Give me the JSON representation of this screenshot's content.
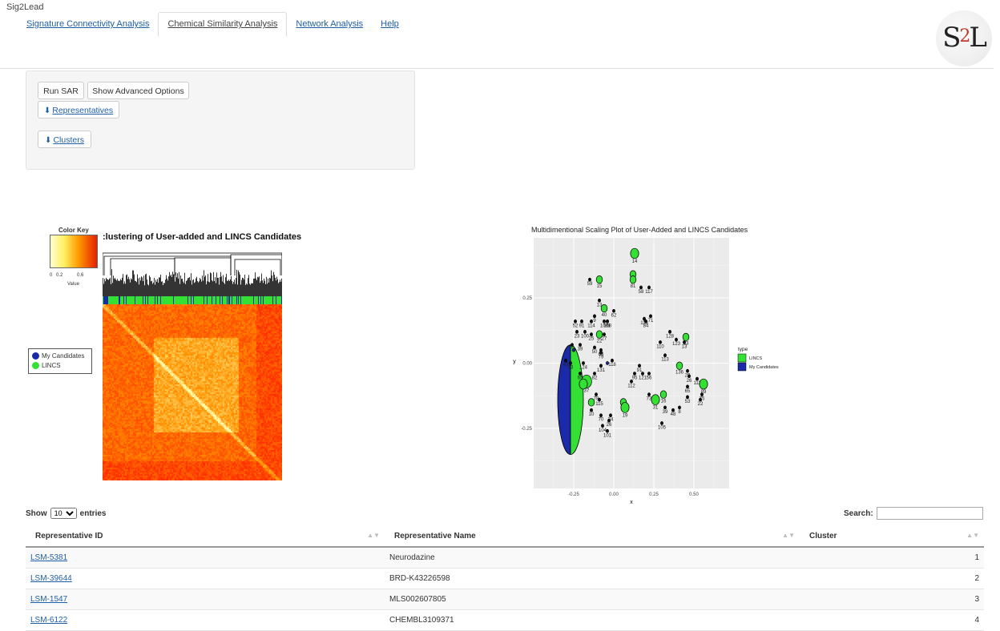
{
  "app": {
    "title": "Sig2Lead",
    "logo_text_s": "S",
    "logo_text_2": "2",
    "logo_text_l": "L"
  },
  "tabs": [
    {
      "label": "Signature Connectivity Analysis",
      "active": false
    },
    {
      "label": "Chemical Similarity Analysis",
      "active": true
    },
    {
      "label": "Network Analysis",
      "active": false
    },
    {
      "label": "Help",
      "active": false
    }
  ],
  "controls": {
    "run_sar": "Run SAR",
    "show_advanced": "Show Advanced Options",
    "representatives": "Representatives",
    "clusters": "Clusters",
    "download_icon": "download-icon"
  },
  "heatmap": {
    "title": ":lustering of User-added and LINCS Candidates",
    "color_key_title": "Color Key",
    "color_key_ticks": [
      "0",
      "0.2",
      "0.6"
    ],
    "color_key_label": "Value",
    "legend": [
      {
        "label": "My Candidates",
        "color": "#1a2aa8"
      },
      {
        "label": "LINCS",
        "color": "#33e033"
      }
    ]
  },
  "chart_data": {
    "type": "scatter",
    "title": "Multidimentional Scaling Plot of User-Added and LINCS Candidates",
    "xlabel": "x",
    "ylabel": "y",
    "xlim": [
      -0.5,
      0.72
    ],
    "ylim": [
      -0.48,
      0.48
    ],
    "x_ticks": [
      "-0.25",
      "0.00",
      "0.25",
      "0.50"
    ],
    "y_ticks": [
      "0.25",
      "0.00",
      "-0.25"
    ],
    "legend_title": "type",
    "legend": [
      {
        "label": "LINCS",
        "color": "#33e033"
      },
      {
        "label": "My Candidates",
        "color": "#1a2aa8"
      }
    ],
    "grid": true,
    "big_point": {
      "x": -0.27,
      "y": -0.14,
      "rx": 0.08,
      "ry": 0.21
    },
    "points": [
      {
        "x": 0.13,
        "y": 0.42,
        "label": "14",
        "s": 4
      },
      {
        "x": 0.12,
        "y": 0.34,
        "label": "12",
        "s": 3
      },
      {
        "x": 0.12,
        "y": 0.32,
        "label": "81",
        "s": 3
      },
      {
        "x": 0.17,
        "y": 0.29,
        "label": "58",
        "s": 2
      },
      {
        "x": 0.22,
        "y": 0.29,
        "label": "117",
        "s": 2
      },
      {
        "x": -0.15,
        "y": 0.32,
        "label": "59",
        "s": 2
      },
      {
        "x": -0.09,
        "y": 0.32,
        "label": "15",
        "s": 3
      },
      {
        "x": -0.09,
        "y": 0.24,
        "label": "13",
        "s": 2
      },
      {
        "x": -0.06,
        "y": 0.21,
        "label": "40",
        "s": 3
      },
      {
        "x": 0.0,
        "y": 0.2,
        "label": "62",
        "s": 2
      },
      {
        "x": -0.04,
        "y": 0.16,
        "label": "98",
        "s": 2
      },
      {
        "x": -0.12,
        "y": 0.18,
        "label": "9",
        "s": 2
      },
      {
        "x": 0.23,
        "y": 0.18,
        "label": "71",
        "s": 2
      },
      {
        "x": 0.19,
        "y": 0.17,
        "label": "116",
        "s": 2
      },
      {
        "x": 0.2,
        "y": 0.16,
        "label": "84",
        "s": 2
      },
      {
        "x": -0.24,
        "y": 0.16,
        "label": "52",
        "s": 2
      },
      {
        "x": -0.2,
        "y": 0.16,
        "label": "91",
        "s": 2
      },
      {
        "x": -0.14,
        "y": 0.16,
        "label": "114",
        "s": 2
      },
      {
        "x": -0.06,
        "y": 0.16,
        "label": "107",
        "s": 2
      },
      {
        "x": -0.04,
        "y": 0.16,
        "label": "108",
        "s": 2
      },
      {
        "x": -0.23,
        "y": 0.12,
        "label": "23",
        "s": 2
      },
      {
        "x": -0.18,
        "y": 0.12,
        "label": "100",
        "s": 2
      },
      {
        "x": -0.14,
        "y": 0.11,
        "label": "25",
        "s": 2
      },
      {
        "x": -0.09,
        "y": 0.11,
        "label": "22",
        "s": 3
      },
      {
        "x": -0.06,
        "y": 0.11,
        "label": "27",
        "s": 2
      },
      {
        "x": 0.35,
        "y": 0.12,
        "label": "128",
        "s": 2
      },
      {
        "x": 0.39,
        "y": 0.09,
        "label": "123",
        "s": 2
      },
      {
        "x": 0.45,
        "y": 0.1,
        "label": "83",
        "s": 3
      },
      {
        "x": 0.44,
        "y": 0.08,
        "label": "13",
        "s": 2
      },
      {
        "x": 0.29,
        "y": 0.08,
        "label": "110",
        "s": 2
      },
      {
        "x": -0.26,
        "y": 0.07,
        "label": "28",
        "s": 2
      },
      {
        "x": -0.21,
        "y": 0.07,
        "label": "39",
        "s": 2
      },
      {
        "x": -0.12,
        "y": 0.06,
        "label": "50",
        "s": 2
      },
      {
        "x": -0.08,
        "y": 0.05,
        "label": "63",
        "s": 2
      },
      {
        "x": -0.08,
        "y": 0.04,
        "label": "79",
        "s": 2
      },
      {
        "x": 0.32,
        "y": 0.03,
        "label": "113",
        "s": 2
      },
      {
        "x": -0.3,
        "y": 0.01,
        "label": "43",
        "s": 2
      },
      {
        "x": -0.27,
        "y": 0.0,
        "label": "33",
        "s": 2
      },
      {
        "x": -0.19,
        "y": 0.0,
        "label": "124",
        "s": 2
      },
      {
        "x": -0.01,
        "y": 0.01,
        "label": "118",
        "s": 2
      },
      {
        "x": -0.08,
        "y": -0.01,
        "label": "131",
        "s": 2
      },
      {
        "x": 0.16,
        "y": -0.01,
        "label": "91",
        "s": 2
      },
      {
        "x": 0.41,
        "y": -0.01,
        "label": "136",
        "s": 3
      },
      {
        "x": 0.46,
        "y": -0.03,
        "label": "29",
        "s": 2
      },
      {
        "x": 0.13,
        "y": -0.04,
        "label": "95",
        "s": 2
      },
      {
        "x": 0.18,
        "y": -0.04,
        "label": "121",
        "s": 2
      },
      {
        "x": 0.22,
        "y": -0.04,
        "label": "56",
        "s": 2
      },
      {
        "x": -0.21,
        "y": -0.04,
        "label": "65",
        "s": 2
      },
      {
        "x": -0.12,
        "y": -0.04,
        "label": "82",
        "s": 2
      },
      {
        "x": 0.47,
        "y": -0.05,
        "label": "26",
        "s": 2
      },
      {
        "x": 0.52,
        "y": -0.06,
        "label": "111",
        "s": 2
      },
      {
        "x": 0.56,
        "y": -0.08,
        "label": "89",
        "s": 4
      },
      {
        "x": 0.46,
        "y": -0.09,
        "label": "65",
        "s": 2
      },
      {
        "x": -0.17,
        "y": -0.07,
        "label": "37",
        "s": 5
      },
      {
        "x": 0.11,
        "y": -0.07,
        "label": "112",
        "s": 2
      },
      {
        "x": 0.31,
        "y": -0.12,
        "label": "16",
        "s": 3
      },
      {
        "x": 0.22,
        "y": -0.12,
        "label": "73",
        "s": 2
      },
      {
        "x": 0.55,
        "y": -0.12,
        "label": "75",
        "s": 2
      },
      {
        "x": 0.54,
        "y": -0.14,
        "label": "22",
        "s": 2
      },
      {
        "x": 0.46,
        "y": -0.13,
        "label": "53",
        "s": 2
      },
      {
        "x": -0.11,
        "y": -0.12,
        "label": "78",
        "s": 2
      },
      {
        "x": -0.09,
        "y": -0.14,
        "label": "115",
        "s": 2
      },
      {
        "x": 0.06,
        "y": -0.15,
        "label": "3",
        "s": 3
      },
      {
        "x": 0.26,
        "y": -0.14,
        "label": "31",
        "s": 4
      },
      {
        "x": 0.41,
        "y": -0.17,
        "label": "8",
        "s": 2
      },
      {
        "x": 0.37,
        "y": -0.18,
        "label": "48",
        "s": 2
      },
      {
        "x": 0.32,
        "y": -0.17,
        "label": "39",
        "s": 2
      },
      {
        "x": -0.14,
        "y": -0.18,
        "label": "10",
        "s": 2
      },
      {
        "x": -0.08,
        "y": -0.2,
        "label": "70",
        "s": 2
      },
      {
        "x": -0.02,
        "y": -0.2,
        "label": "34",
        "s": 2
      },
      {
        "x": 0.07,
        "y": -0.17,
        "label": "19",
        "s": 4
      },
      {
        "x": -0.03,
        "y": -0.22,
        "label": "26",
        "s": 2
      },
      {
        "x": -0.07,
        "y": -0.24,
        "label": "104",
        "s": 2
      },
      {
        "x": -0.04,
        "y": -0.26,
        "label": "101",
        "s": 2
      },
      {
        "x": 0.3,
        "y": -0.23,
        "label": "105",
        "s": 2
      },
      {
        "x": -0.19,
        "y": -0.08,
        "label": "",
        "s": 4
      },
      {
        "x": -0.14,
        "y": -0.15,
        "label": "",
        "s": 3
      },
      {
        "x": -0.25,
        "y": 0.05,
        "label": "",
        "s": 2,
        "blue": true
      },
      {
        "x": -0.04,
        "y": 0.0,
        "label": "",
        "s": 2,
        "blue": true
      }
    ]
  },
  "table": {
    "show_label": "Show",
    "entries_label": "entries",
    "page_size": "10",
    "search_label": "Search:",
    "search_value": "",
    "columns": [
      "Representative ID",
      "Representative Name",
      "Cluster"
    ],
    "rows": [
      {
        "id": "LSM-5381",
        "name": "Neurodazine",
        "cluster": "1"
      },
      {
        "id": "LSM-39644",
        "name": "BRD-K43226598",
        "cluster": "2"
      },
      {
        "id": "LSM-1547",
        "name": "MLS002607805",
        "cluster": "3"
      },
      {
        "id": "LSM-6122",
        "name": "CHEMBL3109371",
        "cluster": "4"
      }
    ]
  }
}
